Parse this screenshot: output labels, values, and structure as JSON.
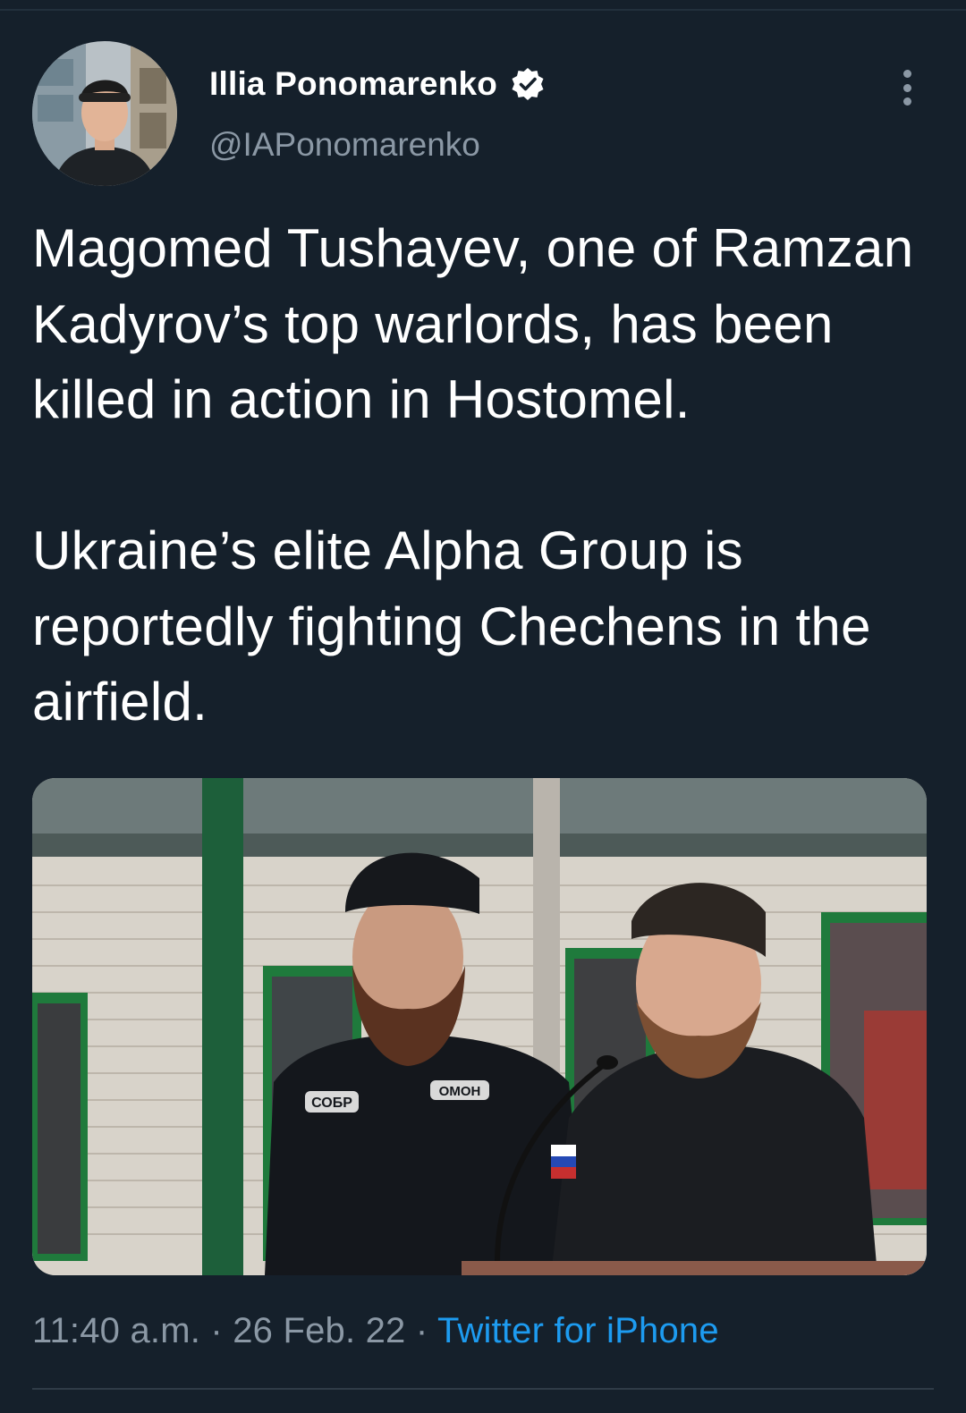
{
  "tweet": {
    "author": {
      "name": "Illia Ponomarenko",
      "handle": "@IAPonomarenko",
      "verified": true
    },
    "text_lines": [
      "Magomed Tushayev, one of Ramzan Kadyrov’s top warlords, has been killed in action in Hostomel.",
      "Ukraine’s elite Alpha Group is reportedly fighting Chechens in the airfield."
    ],
    "flag_icon": "ukraine-flag-emoji",
    "media": {
      "patch_left": "СОБР",
      "patch_right": "ОМОН"
    },
    "time": "11:40 a.m.",
    "separator": "·",
    "date": "26 Feb. 22",
    "source": "Twitter for iPhone"
  },
  "colors": {
    "background": "#15202b",
    "text": "#ffffff",
    "muted": "#8b98a5",
    "link": "#1d9bf0"
  }
}
